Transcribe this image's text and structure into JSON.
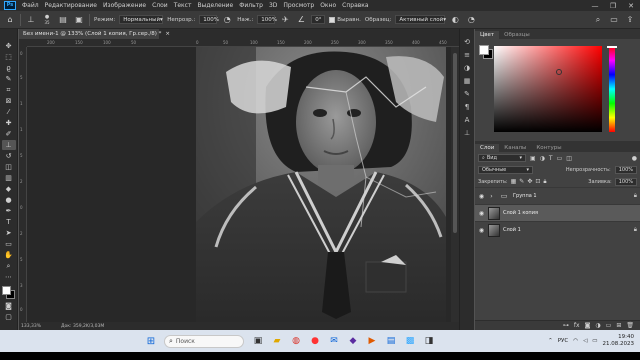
{
  "app": {
    "logo": "Ps"
  },
  "menu": [
    "Файл",
    "Редактирование",
    "Изображение",
    "Слои",
    "Текст",
    "Выделение",
    "Фильтр",
    "3D",
    "Просмотр",
    "Окно",
    "Справка"
  ],
  "window_controls": [
    "—",
    "❐",
    "✕"
  ],
  "options": {
    "brush_size": "35",
    "mode_label": "Режим:",
    "mode_value": "Нормальный",
    "opacity_label": "Непрозр.:",
    "opacity_value": "100%",
    "flow_label": "Наж.:",
    "flow_value": "100%",
    "angle_value": "0°",
    "aligned_label": "Выравн.",
    "sample_label": "Образец:",
    "sample_value": "Активный слой"
  },
  "document": {
    "tab_title": "Без имени-1 @ 133% (Слой 1 копия, Гр.сер./8) *",
    "tab_close": "×",
    "ruler_top_ticks": [
      "200",
      "150",
      "100",
      "50",
      "0",
      "50",
      "100",
      "150",
      "200",
      "250",
      "300",
      "350",
      "400",
      "450"
    ],
    "ruler_left_ticks": [
      "0",
      "5",
      "1",
      "1",
      "5",
      "2",
      "0",
      "2",
      "5",
      "3",
      "0"
    ],
    "zoom_status": "133,33%",
    "doc_status": "Док: 359,2K/3,03M"
  },
  "panels": {
    "color_tabs": [
      "Цвет",
      "Образцы"
    ],
    "layer_tabs": [
      "Слои",
      "Каналы",
      "Контуры"
    ],
    "filter_kind": "Вид",
    "blend_mode": "Обычные",
    "opacity_label": "Непрозрачность:",
    "opacity_value": "100%",
    "lock_label": "Закрепить:",
    "fill_label": "Заливка:",
    "fill_value": "100%",
    "layers": [
      {
        "name": "Группа 1",
        "type": "group",
        "selected": false,
        "locked": true
      },
      {
        "name": "Слой 1 копия",
        "type": "layer",
        "selected": true,
        "locked": false
      },
      {
        "name": "Слой 1",
        "type": "layer",
        "selected": false,
        "locked": true
      }
    ]
  },
  "taskbar": {
    "search_placeholder": "Поиск",
    "lang": "РУС",
    "time": "19:40",
    "date": "21.08.2023"
  },
  "colors": {
    "accent": "#31a8ff",
    "foreground": "#ffffff",
    "background": "#000000"
  }
}
